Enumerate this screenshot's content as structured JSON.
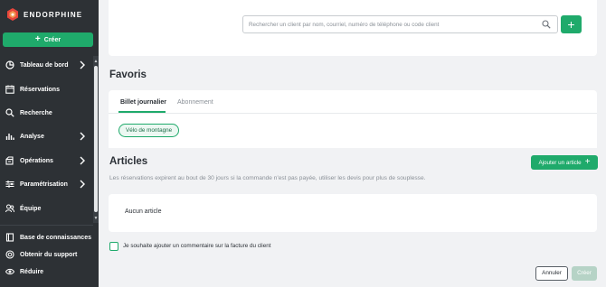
{
  "brand": {
    "name": "ENDORPHINE",
    "logo_icon": "endorphine-logo-icon"
  },
  "sidebar": {
    "create_label": "Créer",
    "items": [
      {
        "label": "Tableau de bord",
        "icon": "dashboard-icon",
        "has_chevron": true
      },
      {
        "label": "Réservations",
        "icon": "calendar-icon",
        "has_chevron": false
      },
      {
        "label": "Recherche",
        "icon": "search-icon",
        "has_chevron": false
      },
      {
        "label": "Analyse",
        "icon": "chart-icon",
        "has_chevron": true
      },
      {
        "label": "Opérations",
        "icon": "operations-icon",
        "has_chevron": true
      },
      {
        "label": "Paramétrisation",
        "icon": "settings-icon",
        "has_chevron": true
      },
      {
        "label": "Équipe",
        "icon": "team-icon",
        "has_chevron": false
      }
    ],
    "bottom_items": [
      {
        "label": "Base de connaissances",
        "icon": "book-icon"
      },
      {
        "label": "Obtenir du support",
        "icon": "support-icon"
      },
      {
        "label": "Réduire",
        "icon": "eye-icon"
      }
    ]
  },
  "search": {
    "placeholder": "Rechercher un client par nom, courriel, numéro de téléphone ou code client"
  },
  "favorites": {
    "title": "Favoris",
    "tabs": [
      {
        "label": "Billet journalier",
        "active": true
      },
      {
        "label": "Abonnement",
        "active": false
      }
    ],
    "chips": [
      "Vélo de montagne"
    ]
  },
  "articles": {
    "title": "Articles",
    "add_label": "Ajouter un article",
    "subtitle": "Les réservations expirent au bout de 30 jours si la commande n'est pas payée, utiliser les devis pour plus de souplesse.",
    "empty_label": "Aucun article"
  },
  "comment_checkbox": {
    "label": "Je souhaite ajouter un commentaire sur la facture du client",
    "checked": false
  },
  "footer": {
    "cancel_label": "Annuler",
    "create_label": "Créer"
  },
  "colors": {
    "accent": "#1faa6b",
    "sidebar_bg": "#2d3135",
    "page_bg": "#f1f2f4"
  }
}
